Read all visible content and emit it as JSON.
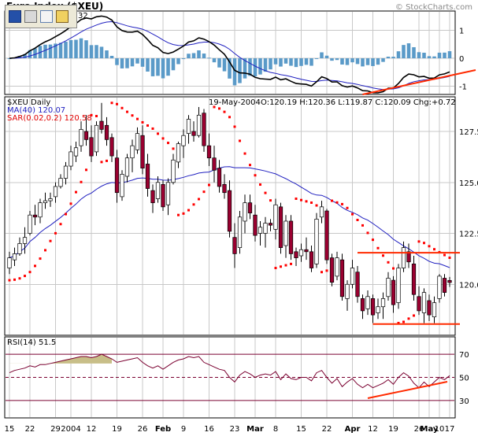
{
  "chart_data": {
    "type": "candlestick",
    "title": "Euro Index ($XEU)",
    "watermark": "© StockCharts.com",
    "macd": {
      "label": "32",
      "y_ticks": [
        "1",
        "0",
        "-1"
      ],
      "ylim": [
        -1.3,
        1.7
      ]
    },
    "price": {
      "symbol_label": "$XEU Daily",
      "date": "19-May-2004",
      "ohlc_text": "O:120.19 H:120.36 L:119.87 C:120.09 Chg:+0.72",
      "ma_label": "MA(40) 120.07",
      "sar_label": "SAR(0.02,0.2) 120.58",
      "y_ticks": [
        "127.5",
        "125.0",
        "122.5",
        "120.0"
      ],
      "ylim": [
        117.5,
        129.2
      ],
      "candles": [
        [
          120.8,
          121.6,
          120.5,
          121.3
        ],
        [
          121.2,
          121.8,
          120.9,
          121.5
        ],
        [
          121.5,
          122.3,
          121.4,
          122.0
        ],
        [
          122.0,
          122.8,
          121.5,
          122.3
        ],
        [
          122.5,
          123.6,
          122.4,
          123.4
        ],
        [
          123.4,
          123.9,
          122.9,
          123.3
        ],
        [
          123.3,
          124.2,
          123.0,
          124.0
        ],
        [
          124.0,
          124.5,
          123.7,
          124.1
        ],
        [
          124.1,
          124.5,
          123.8,
          124.2
        ],
        [
          124.3,
          125.0,
          124.0,
          124.8
        ],
        [
          124.8,
          125.4,
          124.7,
          125.2
        ],
        [
          125.2,
          126.0,
          124.9,
          125.8
        ],
        [
          125.8,
          126.8,
          125.6,
          126.5
        ],
        [
          126.3,
          127.0,
          126.0,
          126.7
        ],
        [
          126.8,
          128.0,
          126.5,
          127.6
        ],
        [
          127.5,
          128.3,
          126.8,
          127.1
        ],
        [
          127.2,
          127.8,
          126.0,
          126.3
        ],
        [
          126.5,
          128.0,
          126.3,
          127.8
        ],
        [
          128.0,
          128.9,
          127.4,
          127.6
        ],
        [
          127.8,
          128.2,
          126.8,
          127.1
        ],
        [
          127.2,
          127.4,
          126.0,
          126.3
        ],
        [
          126.2,
          126.6,
          124.0,
          124.5
        ],
        [
          124.3,
          125.6,
          124.1,
          125.4
        ],
        [
          125.3,
          126.4,
          125.0,
          126.2
        ],
        [
          126.2,
          127.1,
          125.5,
          126.8
        ],
        [
          126.6,
          127.7,
          126.4,
          127.4
        ],
        [
          127.3,
          127.8,
          125.4,
          125.7
        ],
        [
          125.9,
          126.4,
          124.3,
          124.7
        ],
        [
          124.6,
          124.9,
          123.5,
          124.0
        ],
        [
          124.2,
          125.3,
          124.0,
          125.0
        ],
        [
          124.9,
          125.1,
          123.6,
          123.8
        ],
        [
          123.9,
          125.2,
          123.4,
          125.0
        ],
        [
          125.0,
          126.4,
          124.9,
          126.1
        ],
        [
          126.0,
          127.0,
          125.7,
          126.9
        ],
        [
          126.8,
          127.6,
          126.2,
          127.3
        ],
        [
          127.4,
          128.3,
          126.9,
          128.1
        ],
        [
          127.5,
          128.0,
          127.0,
          127.3
        ],
        [
          127.3,
          128.7,
          127.2,
          128.3
        ],
        [
          128.4,
          128.6,
          126.5,
          126.8
        ],
        [
          126.8,
          127.4,
          125.8,
          126.2
        ],
        [
          126.2,
          126.8,
          125.0,
          125.6
        ],
        [
          125.7,
          126.1,
          124.5,
          124.8
        ],
        [
          124.9,
          125.4,
          124.2,
          124.5
        ],
        [
          124.6,
          125.1,
          122.3,
          122.6
        ],
        [
          122.3,
          123.0,
          120.8,
          121.5
        ],
        [
          121.8,
          123.6,
          121.5,
          123.3
        ],
        [
          123.1,
          124.4,
          122.5,
          124.0
        ],
        [
          124.0,
          124.4,
          123.2,
          123.5
        ],
        [
          123.4,
          123.9,
          122.1,
          122.4
        ],
        [
          122.5,
          123.1,
          121.9,
          122.8
        ],
        [
          122.5,
          123.3,
          121.8,
          123.0
        ],
        [
          123.0,
          123.2,
          122.6,
          122.9
        ],
        [
          122.7,
          124.2,
          122.2,
          123.9
        ],
        [
          123.8,
          124.0,
          121.5,
          121.8
        ],
        [
          121.9,
          123.4,
          121.3,
          123.1
        ],
        [
          123.1,
          123.4,
          121.2,
          121.5
        ],
        [
          121.6,
          121.8,
          120.9,
          121.3
        ],
        [
          121.4,
          122.0,
          121.1,
          121.7
        ],
        [
          121.7,
          122.3,
          121.2,
          121.6
        ],
        [
          121.6,
          121.9,
          120.6,
          120.8
        ],
        [
          121.0,
          123.5,
          120.8,
          123.2
        ],
        [
          123.3,
          124.1,
          123.0,
          123.8
        ],
        [
          123.6,
          123.7,
          121.0,
          121.2
        ],
        [
          121.3,
          121.5,
          119.9,
          120.1
        ],
        [
          120.4,
          121.6,
          120.2,
          121.3
        ],
        [
          121.2,
          121.5,
          119.2,
          119.4
        ],
        [
          119.3,
          120.2,
          118.7,
          120.0
        ],
        [
          120.0,
          121.2,
          119.8,
          120.8
        ],
        [
          120.6,
          120.9,
          119.1,
          119.4
        ],
        [
          119.3,
          119.5,
          118.3,
          118.7
        ],
        [
          118.8,
          119.7,
          118.5,
          119.4
        ],
        [
          119.3,
          119.5,
          118.1,
          118.5
        ],
        [
          118.6,
          119.3,
          118.3,
          118.9
        ],
        [
          118.9,
          119.6,
          118.3,
          119.3
        ],
        [
          119.4,
          120.6,
          119.2,
          120.3
        ],
        [
          120.2,
          120.4,
          118.6,
          119.0
        ],
        [
          119.1,
          121.0,
          118.8,
          120.8
        ],
        [
          120.8,
          122.1,
          120.6,
          121.8
        ],
        [
          121.6,
          122.0,
          120.8,
          121.1
        ],
        [
          121.0,
          121.4,
          119.2,
          119.5
        ],
        [
          119.4,
          119.9,
          118.5,
          118.7
        ],
        [
          118.6,
          119.8,
          118.1,
          119.6
        ],
        [
          119.2,
          119.5,
          118.2,
          118.5
        ],
        [
          118.4,
          119.4,
          118.1,
          119.1
        ],
        [
          119.3,
          120.5,
          119.1,
          120.4
        ],
        [
          120.3,
          120.5,
          119.4,
          119.6
        ],
        [
          120.19,
          120.36,
          119.87,
          120.09
        ]
      ]
    },
    "rsi": {
      "label": "RSI(14)",
      "value": "51.5",
      "y_ticks": [
        "70",
        "50",
        "30"
      ],
      "ylim": [
        15,
        85
      ],
      "values": [
        54,
        56,
        57,
        58,
        60,
        59,
        61,
        61,
        62,
        63,
        64,
        65,
        66,
        67,
        68,
        68,
        67,
        68,
        70,
        68,
        66,
        63,
        64,
        65,
        66,
        67,
        63,
        60,
        58,
        60,
        57,
        60,
        63,
        65,
        66,
        68,
        67,
        68,
        63,
        61,
        59,
        57,
        56,
        50,
        46,
        52,
        55,
        53,
        50,
        52,
        53,
        52,
        55,
        48,
        53,
        49,
        48,
        50,
        50,
        47,
        54,
        56,
        50,
        45,
        49,
        42,
        46,
        49,
        44,
        41,
        44,
        41,
        43,
        45,
        48,
        44,
        50,
        54,
        51,
        45,
        41,
        46,
        42,
        46,
        50,
        48,
        51.5
      ]
    },
    "x_labels": [
      "15",
      "22",
      "29",
      "2004",
      "12",
      "19",
      "26",
      "Feb",
      "9",
      "16",
      "23",
      "Mar",
      "8",
      "15",
      "22",
      "Apr",
      "12",
      "19",
      "26",
      "May",
      "10",
      "17"
    ],
    "annotations": "red horizontal support and resistance lines; red rising trend lines on MACD and RSI"
  }
}
